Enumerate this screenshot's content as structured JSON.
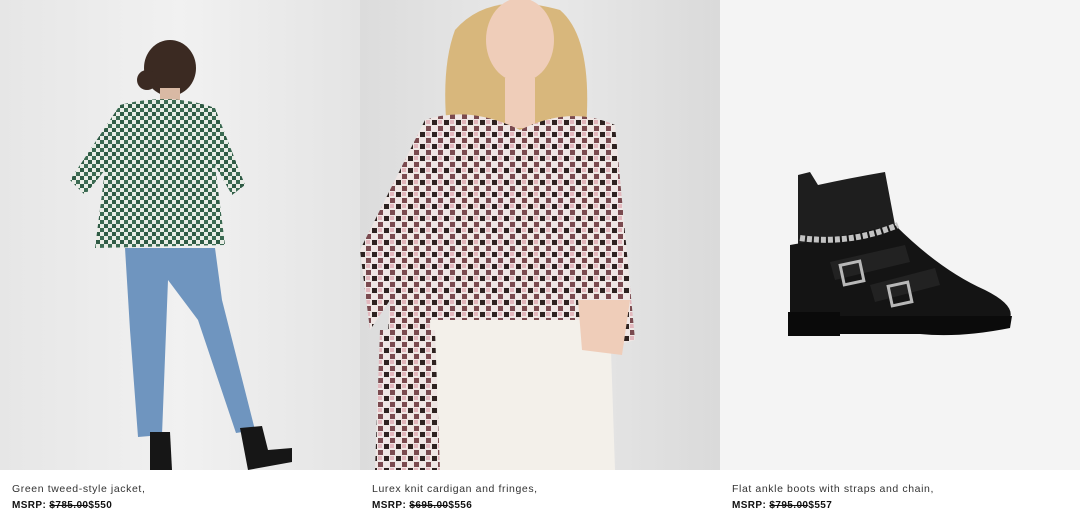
{
  "products": [
    {
      "image_name": "green tweed-style jacket photo",
      "title": "Green tweed-style jacket,",
      "msrp_label": "MSRP:",
      "old_price": "$785.00",
      "new_price": "$550"
    },
    {
      "image_name": "lurex knit cardigan photo",
      "title": "Lurex knit cardigan and fringes,",
      "msrp_label": "MSRP:",
      "old_price": "$695.00",
      "new_price": "$556"
    },
    {
      "image_name": "flat ankle boots photo",
      "title": "Flat ankle boots with straps and chain,",
      "msrp_label": "MSRP:",
      "old_price": "$795.00",
      "new_price": "$557"
    }
  ]
}
